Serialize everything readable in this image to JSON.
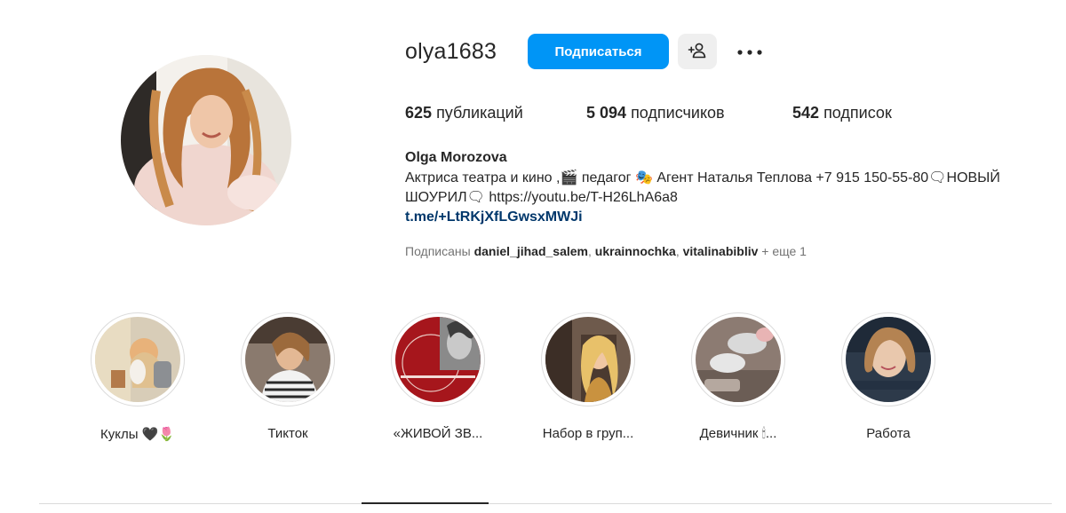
{
  "profile": {
    "username": "olya1683",
    "follow_label": "Подписаться",
    "suggest_icon": "add-person-icon",
    "more_icon": "more-dots-icon"
  },
  "stats": {
    "posts_count": "625",
    "posts_label": "публикаций",
    "followers_count": "5 094",
    "followers_label": "подписчиков",
    "following_count": "542",
    "following_label": "подписок"
  },
  "bio": {
    "full_name": "Olga Morozova",
    "text": "Актриса театра и кино ,🎬 педагог 🎭 Агент Наталья Теплова +7 915 150-55-80🗨НОВЫЙ ШОУРИЛ🗨 https://youtu.be/T-H26LhA6a8",
    "link": "t.me/+LtRKjXfLGwsxMWJi",
    "followed_by_label": "Подписаны",
    "followed_by_users": [
      "daniel_jihad_salem",
      "ukrainnochka",
      "vitalinabibliv"
    ],
    "followed_by_more": "+ еще 1"
  },
  "highlights": [
    {
      "label": "Куклы 🖤🌷"
    },
    {
      "label": "Тикток"
    },
    {
      "label": "«ЖИВОЙ ЗВ..."
    },
    {
      "label": "Набор в груп..."
    },
    {
      "label": "Девичник 🕯..."
    },
    {
      "label": "Работа"
    }
  ],
  "colors": {
    "accent": "#0095f6",
    "link": "#00376b",
    "text": "#262626",
    "muted": "#737373",
    "border": "#dbdbdb"
  }
}
